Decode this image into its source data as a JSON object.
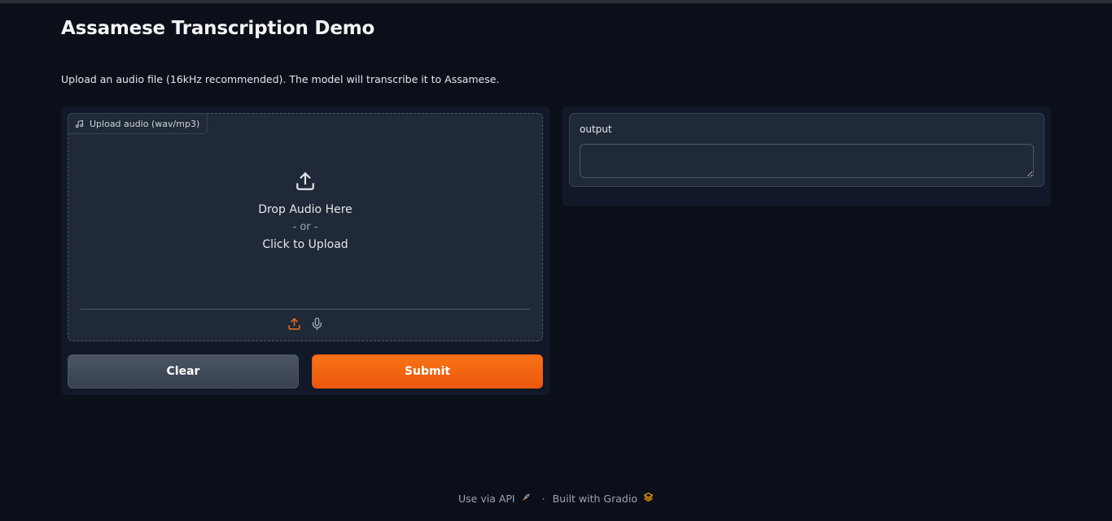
{
  "app": {
    "title": "Assamese Transcription Demo",
    "description": "Upload an audio file (16kHz recommended). The model will transcribe it to Assamese."
  },
  "audio_input": {
    "label": "Upload audio (wav/mp3)",
    "label_icon": "music-note-icon",
    "drop_text": "Drop Audio Here",
    "or_text": "- or -",
    "click_text": "Click to Upload",
    "upload_icon": "upload-icon",
    "source_upload_icon": "upload-icon",
    "source_mic_icon": "microphone-icon"
  },
  "buttons": {
    "clear_label": "Clear",
    "submit_label": "Submit"
  },
  "output": {
    "label": "output",
    "value": ""
  },
  "footer": {
    "api_label": "Use via API",
    "api_icon": "rocket-icon",
    "separator": "·",
    "built_label": "Built with Gradio",
    "built_icon": "gradio-logo-icon"
  },
  "colors": {
    "background": "#0b0f19",
    "panel": "#111827",
    "block": "#1f2937",
    "accent": "#f97316",
    "secondary_button": "#4b5563"
  }
}
